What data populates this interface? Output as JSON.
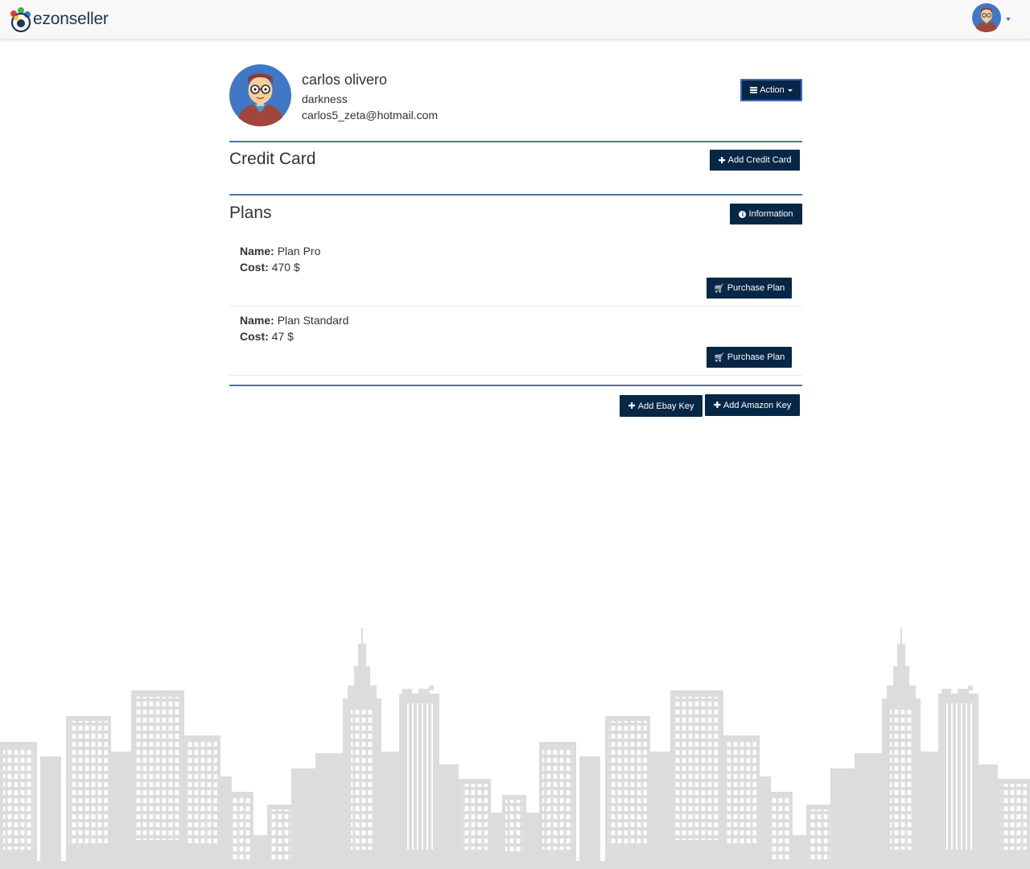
{
  "navbar": {
    "brand": "ezonseller"
  },
  "profile": {
    "name": "carlos olivero",
    "username": "darkness",
    "email": "carlos5_zeta@hotmail.com",
    "action_label": "Action"
  },
  "credit_card": {
    "title": "Credit Card",
    "add_label": "Add Credit Card"
  },
  "plans": {
    "title": "Plans",
    "info_label": "Information",
    "name_label": "Name:",
    "cost_label": "Cost:",
    "items": [
      {
        "name": "Plan Pro",
        "cost": "470 $",
        "purchase_label": "Purchase Plan"
      },
      {
        "name": "Plan Standard",
        "cost": "47 $",
        "purchase_label": "Purchase Plan"
      }
    ]
  },
  "keys": {
    "ebay_label": "Add Ebay Key",
    "amazon_label": "Add Amazon Key"
  },
  "colors": {
    "button_bg": "#072746",
    "divider": "#4e73a2",
    "navbar_bg": "#f8f8f8",
    "city_gray": "#dcdcdc"
  },
  "icons": [
    "avatar-icon",
    "bars-icon",
    "plus-icon",
    "info-circle-icon",
    "cart-icon",
    "caret-down-icon"
  ]
}
